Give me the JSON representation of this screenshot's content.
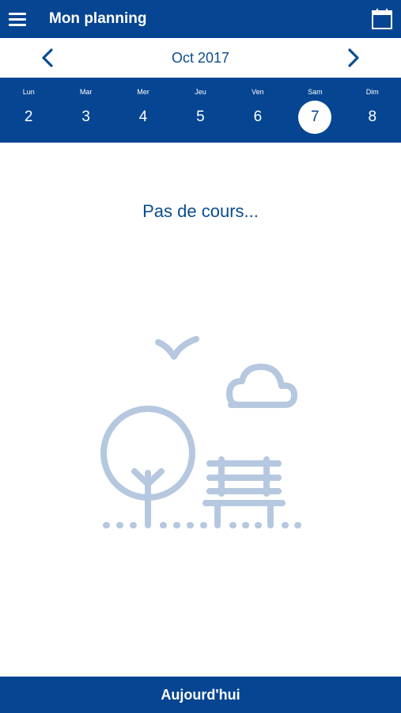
{
  "header": {
    "title": "Mon planning",
    "menu_icon": "hamburger-menu-icon",
    "calendar_icon": "calendar-icon"
  },
  "month_nav": {
    "label": "Oct 2017",
    "prev_icon": "chevron-left-icon",
    "next_icon": "chevron-right-icon"
  },
  "days": [
    {
      "name": "Lun",
      "num": "2",
      "selected": false
    },
    {
      "name": "Mar",
      "num": "3",
      "selected": false
    },
    {
      "name": "Mer",
      "num": "4",
      "selected": false
    },
    {
      "name": "Jeu",
      "num": "5",
      "selected": false
    },
    {
      "name": "Ven",
      "num": "6",
      "selected": false
    },
    {
      "name": "Sam",
      "num": "7",
      "selected": true
    },
    {
      "name": "Dim",
      "num": "8",
      "selected": false
    }
  ],
  "empty_state": {
    "message": "Pas de cours...",
    "illustration": "park-bench-tree-illustration"
  },
  "footer": {
    "today_label": "Aujourd'hui"
  },
  "colors": {
    "primary": "#054592",
    "text_blue": "#0a4d8f",
    "illustration": "#b5c8df"
  }
}
